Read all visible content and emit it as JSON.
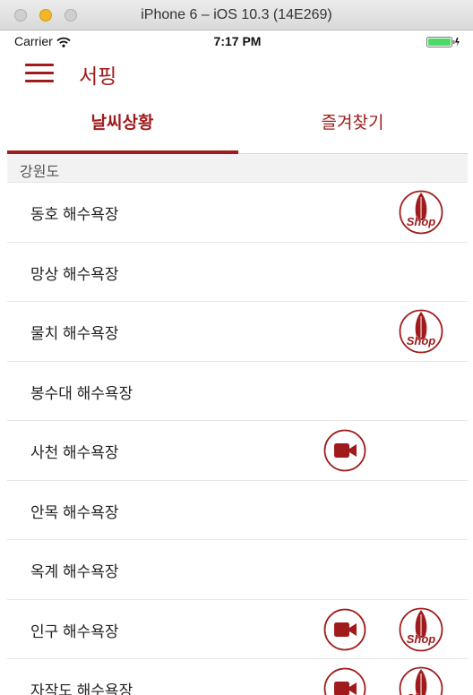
{
  "window": {
    "title": "iPhone 6 – iOS 10.3 (14E269)"
  },
  "status_bar": {
    "carrier": "Carrier",
    "time": "7:17 PM"
  },
  "header": {
    "title": "서핑"
  },
  "tabs": [
    {
      "label": "날씨상황",
      "active": true
    },
    {
      "label": "즐겨찾기",
      "active": false
    }
  ],
  "section": {
    "title": "강원도"
  },
  "icons": {
    "shop_text": "Shop"
  },
  "list": [
    {
      "label": "동호 해수욕장",
      "cam": false,
      "shop": true
    },
    {
      "label": "망상 해수욕장",
      "cam": false,
      "shop": false
    },
    {
      "label": "물치 해수욕장",
      "cam": false,
      "shop": true
    },
    {
      "label": "봉수대 해수욕장",
      "cam": false,
      "shop": false
    },
    {
      "label": "사천 해수욕장",
      "cam": true,
      "shop": false
    },
    {
      "label": "안목 해수욕장",
      "cam": false,
      "shop": false
    },
    {
      "label": "옥계 해수욕장",
      "cam": false,
      "shop": false
    },
    {
      "label": "인구 해수욕장",
      "cam": true,
      "shop": true
    },
    {
      "label": "자작도 해수욕장",
      "cam": true,
      "shop": true
    }
  ],
  "colors": {
    "accent": "#a01c1c",
    "battery": "#4cd964"
  }
}
